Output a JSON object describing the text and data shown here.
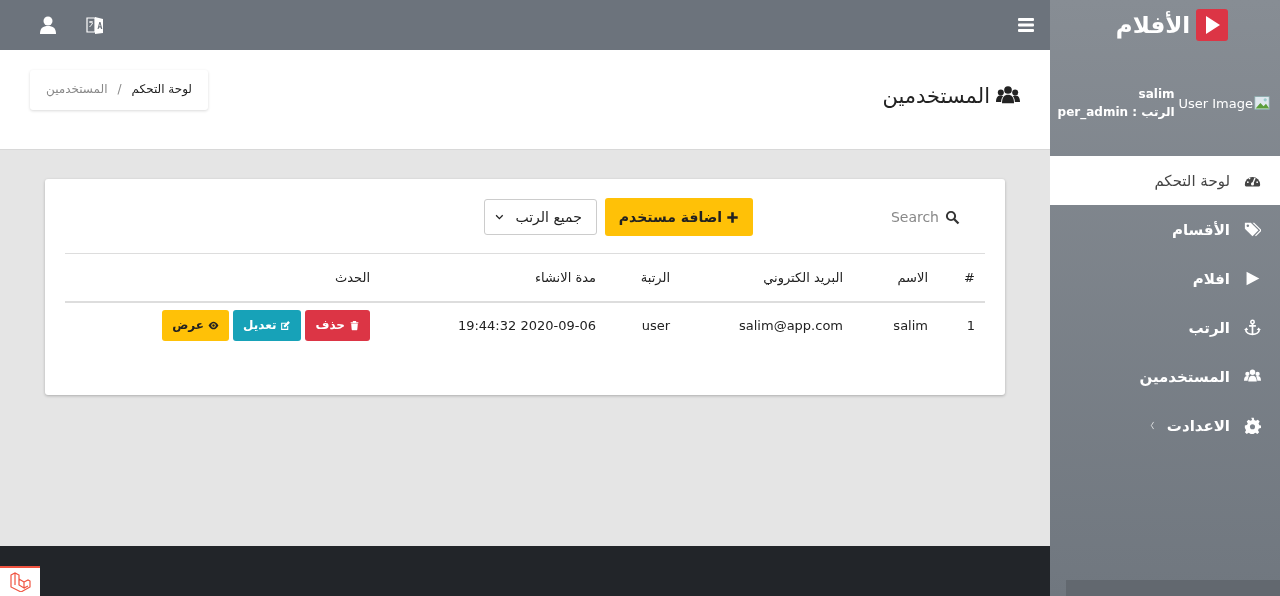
{
  "sidebar": {
    "brand": "الأفلام",
    "user": {
      "image_alt": "User Image",
      "name": "salim",
      "role": "الرتب : per_admin"
    },
    "items": [
      {
        "label": "لوحة التحكم",
        "kind": "dashboard",
        "selected": true
      },
      {
        "label": "الأقسام",
        "kind": "tags",
        "selected": false
      },
      {
        "label": "افلام",
        "kind": "play",
        "selected": false
      },
      {
        "label": "الرتب",
        "kind": "anchor",
        "selected": false
      },
      {
        "label": "المستخدمين",
        "kind": "users",
        "selected": false
      },
      {
        "label": "الاعدادت",
        "kind": "settings",
        "selected": false
      }
    ]
  },
  "header": {
    "title": "المستخدمين",
    "breadcrumb": [
      {
        "label": "لوحة التحكم",
        "current": false
      },
      {
        "label": "المستخدمين",
        "current": true
      }
    ],
    "separator": "/"
  },
  "toolbar": {
    "search_placeholder": "Search",
    "add_button": "اضافة مستخدم",
    "role_filter": "جميع الرتب"
  },
  "table": {
    "columns": [
      "#",
      "الاسم",
      "البريد الكتروني",
      "الرتبة",
      "مدة الانشاء",
      "الحدث"
    ],
    "rows": [
      {
        "cells": [
          "1",
          "salim",
          "salim@app.com",
          "user",
          "2020-09-06 19:44:32"
        ],
        "actions": [
          {
            "kind": "delete",
            "label": "حذف"
          },
          {
            "kind": "edit",
            "label": "تعديل"
          },
          {
            "kind": "view",
            "label": "عرض"
          }
        ]
      }
    ]
  }
}
